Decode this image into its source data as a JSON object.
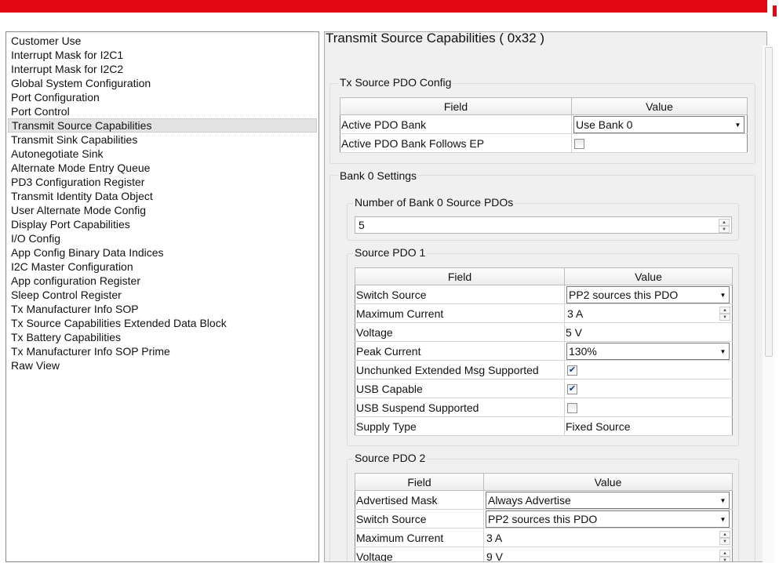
{
  "sidebar": {
    "items": [
      "Customer Use",
      "Interrupt Mask for I2C1",
      "Interrupt Mask for I2C2",
      "Global System Configuration",
      "Port Configuration",
      "Port Control",
      "Transmit Source Capabilities",
      "Transmit Sink Capabilities",
      "Autonegotiate Sink",
      "Alternate Mode Entry Queue",
      "PD3 Configuration Register",
      "Transmit Identity Data Object",
      "User Alternate Mode Config",
      "Display Port Capabilities",
      "I/O Config",
      "App Config Binary Data Indices",
      "I2C Master Configuration",
      "App configuration Register",
      "Sleep Control Register",
      "Tx Manufacturer Info SOP",
      "Tx Source Capabilities Extended Data Block",
      "Tx Battery Capabilities",
      "Tx Manufacturer Info SOP Prime",
      "Raw View"
    ],
    "selected": "Transmit Source Capabilities"
  },
  "main": {
    "title": "Transmit Source Capabilities  ( 0x32 )",
    "tx_config": {
      "title": "Tx Source PDO Config",
      "col_field": "Field",
      "col_value": "Value",
      "active_bank_label": "Active PDO Bank",
      "active_bank_value": "Use Bank 0",
      "follows_ep_label": "Active PDO Bank Follows EP",
      "follows_ep_checked": false
    },
    "bank0": {
      "title": "Bank 0 Settings",
      "num_pdos_title": "Number of Bank 0 Source PDOs",
      "num_pdos_value": "5",
      "pdo1": {
        "title": "Source PDO 1",
        "col_field": "Field",
        "col_value": "Value",
        "switch_source_label": "Switch Source",
        "switch_source_value": "PP2 sources this PDO",
        "max_current_label": "Maximum Current",
        "max_current_value": "3 A",
        "voltage_label": "Voltage",
        "voltage_value": "5 V",
        "peak_current_label": "Peak Current",
        "peak_current_value": "130%",
        "unchunked_label": "Unchunked Extended Msg Supported",
        "unchunked_checked": true,
        "usb_capable_label": "USB Capable",
        "usb_capable_checked": true,
        "usb_suspend_label": "USB Suspend Supported",
        "usb_suspend_checked": false,
        "supply_type_label": "Supply Type",
        "supply_type_value": "Fixed Source"
      },
      "pdo2": {
        "title": "Source PDO 2",
        "col_field": "Field",
        "col_value": "Value",
        "advertised_mask_label": "Advertised Mask",
        "advertised_mask_value": "Always Advertise",
        "switch_source_label": "Switch Source",
        "switch_source_value": "PP2 sources this PDO",
        "max_current_label": "Maximum Current",
        "max_current_value": "3 A",
        "voltage_label": "Voltage",
        "voltage_value": "9 V"
      }
    }
  },
  "colors": {
    "brand_bar": "#e30613",
    "panel_bg": "#f0f0f0",
    "check": "#1a3d7c"
  },
  "icons": {
    "dropdown": "chevron-down-icon",
    "spin_up": "spin-up-icon",
    "spin_down": "spin-down-icon",
    "check": "checkmark-icon"
  }
}
